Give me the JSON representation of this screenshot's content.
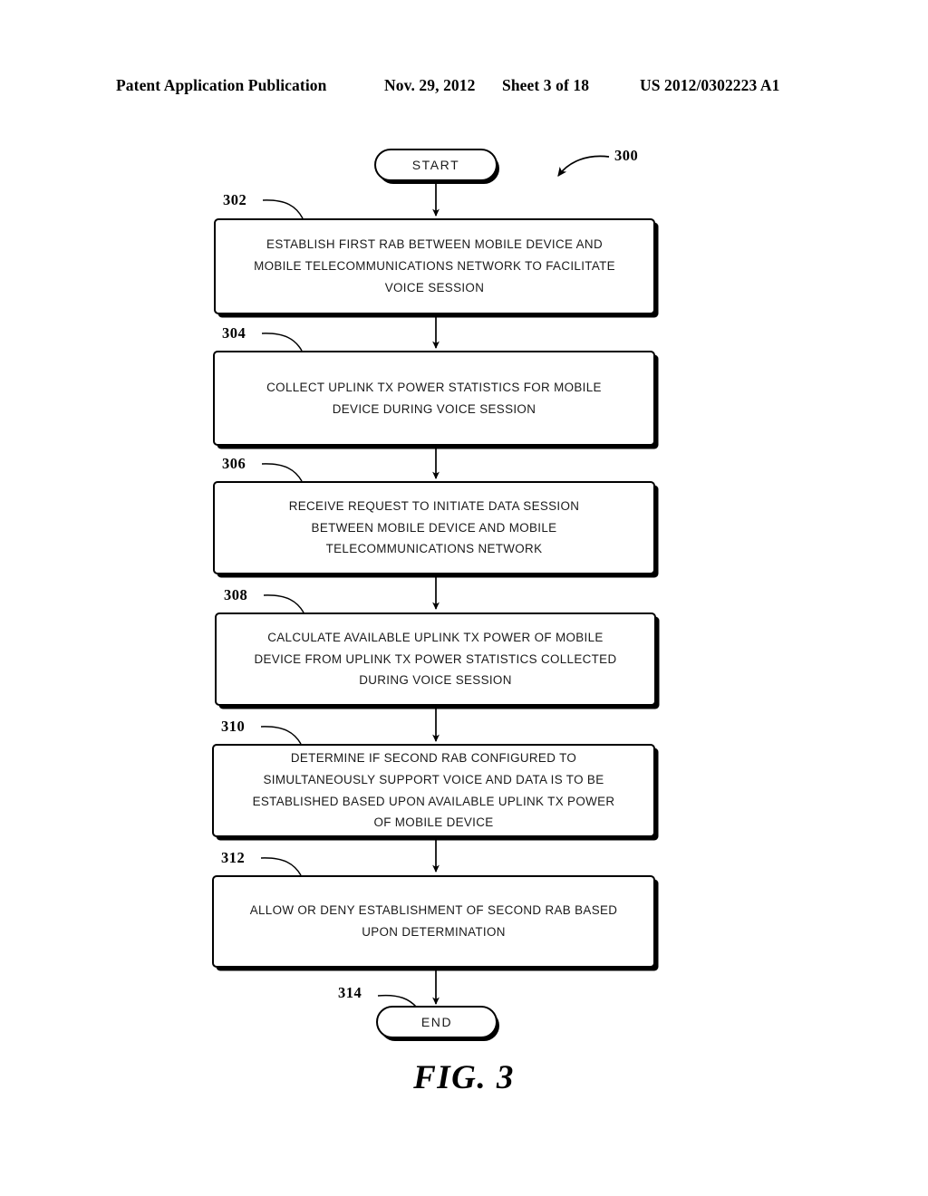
{
  "header": {
    "publication": "Patent Application Publication",
    "date": "Nov. 29, 2012",
    "sheet": "Sheet 3 of 18",
    "number": "US 2012/0302223 A1"
  },
  "figure": {
    "caption": "FIG. 3",
    "diagram_numeral": "300",
    "type": "flowchart"
  },
  "flow": {
    "start": {
      "label": "START",
      "shape": "stadium"
    },
    "end": {
      "label": "END",
      "shape": "stadium",
      "numeral": "314"
    },
    "steps": [
      {
        "numeral": "302",
        "text": "ESTABLISH FIRST RAB BETWEEN MOBILE DEVICE AND\nMOBILE TELECOMMUNICATIONS NETWORK TO FACILITATE\nVOICE SESSION"
      },
      {
        "numeral": "304",
        "text": "COLLECT UPLINK TX POWER STATISTICS FOR MOBILE\nDEVICE DURING VOICE SESSION"
      },
      {
        "numeral": "306",
        "text": "RECEIVE REQUEST TO INITIATE DATA SESSION\nBETWEEN MOBILE DEVICE AND MOBILE\nTELECOMMUNICATIONS NETWORK"
      },
      {
        "numeral": "308",
        "text": "CALCULATE AVAILABLE UPLINK TX POWER OF MOBILE\nDEVICE FROM UPLINK TX POWER STATISTICS COLLECTED\nDURING VOICE SESSION"
      },
      {
        "numeral": "310",
        "text": "DETERMINE IF SECOND RAB CONFIGURED TO\nSIMULTANEOUSLY SUPPORT VOICE AND DATA IS TO BE\nESTABLISHED BASED UPON AVAILABLE UPLINK TX POWER\nOF MOBILE DEVICE"
      },
      {
        "numeral": "312",
        "text": "ALLOW OR DENY ESTABLISHMENT OF SECOND RAB BASED\nUPON DETERMINATION"
      }
    ]
  }
}
